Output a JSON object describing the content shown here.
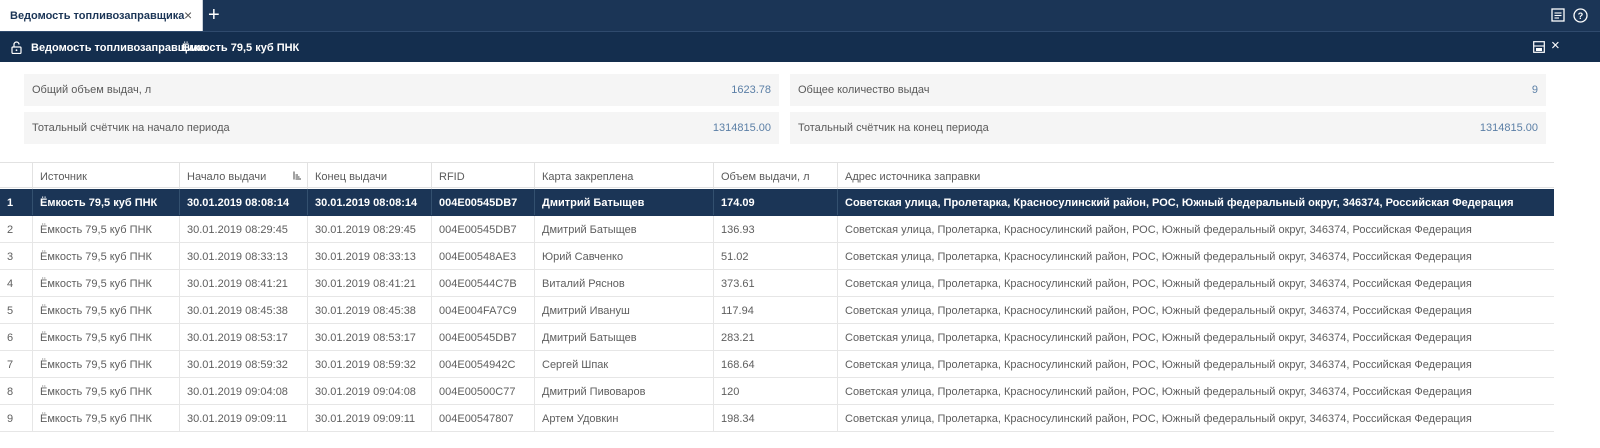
{
  "tabs": [
    {
      "label": "Ведомость топливозаправщика",
      "close": "×"
    }
  ],
  "tab_add": "+",
  "toolbar_icons": [
    "report-icon",
    "help-icon"
  ],
  "title_bar": {
    "title": "Ведомость топливозаправщика",
    "subtitle": "Ёмкость 79,5 куб ПНК",
    "close": "×"
  },
  "summary": {
    "total_volume_label": "Общий объем выдач, л",
    "total_volume_value": "1623.78",
    "total_count_label": "Общее количество выдач",
    "total_count_value": "9",
    "counter_start_label": "Тотальный счётчик на начало периода",
    "counter_start_value": "1314815.00",
    "counter_end_label": "Тотальный счётчик на конец периода",
    "counter_end_value": "1314815.00"
  },
  "table": {
    "columns": [
      "",
      "Источник",
      "Начало выдачи",
      "Конец выдачи",
      "RFID",
      "Карта закреплена",
      "Объем выдачи, л",
      "Адрес источника заправки"
    ],
    "rows": [
      [
        "1",
        "Ёмкость 79,5 куб ПНК",
        "30.01.2019 08:08:14",
        "30.01.2019 08:08:14",
        "004E00545DB7",
        "Дмитрий Батыщев",
        "174.09",
        "Советская улица, Пролетарка, Красносулинский район, РОС, Южный федеральный округ, 346374, Российская Федерация"
      ],
      [
        "2",
        "Ёмкость 79,5 куб ПНК",
        "30.01.2019 08:29:45",
        "30.01.2019 08:29:45",
        "004E00545DB7",
        "Дмитрий Батыщев",
        "136.93",
        "Советская улица, Пролетарка, Красносулинский район, РОС, Южный федеральный округ, 346374, Российская Федерация"
      ],
      [
        "3",
        "Ёмкость 79,5 куб ПНК",
        "30.01.2019 08:33:13",
        "30.01.2019 08:33:13",
        "004E00548AE3",
        "Юрий Савченко",
        "51.02",
        "Советская улица, Пролетарка, Красносулинский район, РОС, Южный федеральный округ, 346374, Российская Федерация"
      ],
      [
        "4",
        "Ёмкость 79,5 куб ПНК",
        "30.01.2019 08:41:21",
        "30.01.2019 08:41:21",
        "004E00544C7B",
        "Виталий Ряснов",
        "373.61",
        "Советская улица, Пролетарка, Красносулинский район, РОС, Южный федеральный округ, 346374, Российская Федерация"
      ],
      [
        "5",
        "Ёмкость 79,5 куб ПНК",
        "30.01.2019 08:45:38",
        "30.01.2019 08:45:38",
        "004E004FA7C9",
        "Дмитрий Ивануш",
        "117.94",
        "Советская улица, Пролетарка, Красносулинский район, РОС, Южный федеральный округ, 346374, Российская Федерация"
      ],
      [
        "6",
        "Ёмкость 79,5 куб ПНК",
        "30.01.2019 08:53:17",
        "30.01.2019 08:53:17",
        "004E00545DB7",
        "Дмитрий Батыщев",
        "283.21",
        "Советская улица, Пролетарка, Красносулинский район, РОС, Южный федеральный округ, 346374, Российская Федерация"
      ],
      [
        "7",
        "Ёмкость 79,5 куб ПНК",
        "30.01.2019 08:59:32",
        "30.01.2019 08:59:32",
        "004E0054942C",
        "Сергей Шпак",
        "168.64",
        "Советская улица, Пролетарка, Красносулинский район, РОС, Южный федеральный округ, 346374, Российская Федерация"
      ],
      [
        "8",
        "Ёмкость 79,5 куб ПНК",
        "30.01.2019 09:04:08",
        "30.01.2019 09:04:08",
        "004E00500C77",
        "Дмитрий Пивоваров",
        "120",
        "Советская улица, Пролетарка, Красносулинский район, РОС, Южный федеральный округ, 346374, Российская Федерация"
      ],
      [
        "9",
        "Ёмкость 79,5 куб ПНК",
        "30.01.2019 09:09:11",
        "30.01.2019 09:09:11",
        "004E00547807",
        "Артем Удовкин",
        "198.34",
        "Советская улица, Пролетарка, Красносулинский район, РОС, Южный федеральный округ, 346374, Российская Федерация"
      ]
    ],
    "selected_row": 0
  },
  "colors": {
    "header_bg": "#1b3556",
    "selected_row": "#1b3556",
    "value_text": "#5b7fa6"
  }
}
